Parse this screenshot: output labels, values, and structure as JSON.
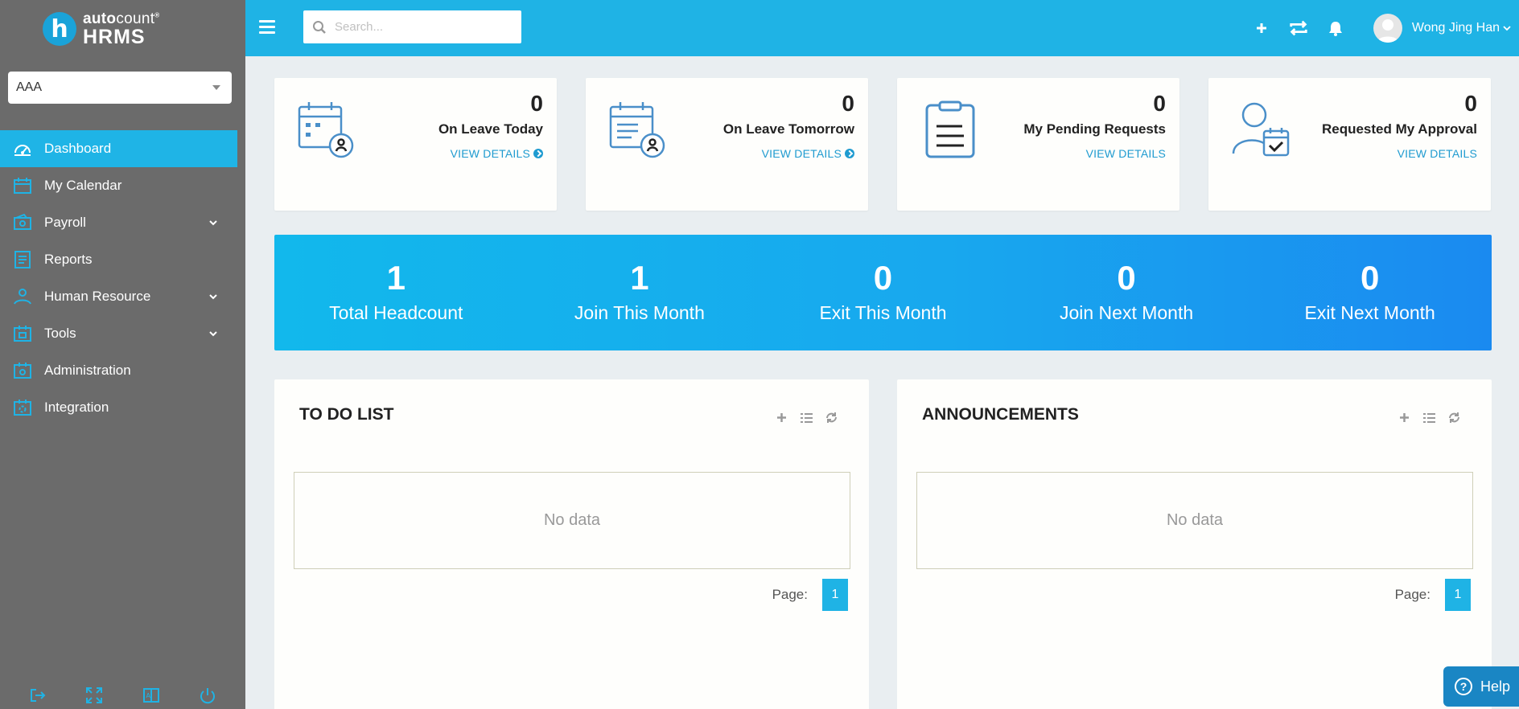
{
  "brand": {
    "badge": "h",
    "line1_bold": "auto",
    "line1_light": "count",
    "line2": "HRMS"
  },
  "company": {
    "selected": "AAA"
  },
  "sidebar": {
    "items": [
      {
        "label": "Dashboard",
        "icon": "dashboard-icon",
        "active": true,
        "expandable": false
      },
      {
        "label": "My Calendar",
        "icon": "calendar-icon",
        "active": false,
        "expandable": false
      },
      {
        "label": "Payroll",
        "icon": "payroll-icon",
        "active": false,
        "expandable": true
      },
      {
        "label": "Reports",
        "icon": "reports-icon",
        "active": false,
        "expandable": false
      },
      {
        "label": "Human Resource",
        "icon": "human-resource-icon",
        "active": false,
        "expandable": true
      },
      {
        "label": "Tools",
        "icon": "tools-icon",
        "active": false,
        "expandable": true
      },
      {
        "label": "Administration",
        "icon": "administration-icon",
        "active": false,
        "expandable": false
      },
      {
        "label": "Integration",
        "icon": "integration-icon",
        "active": false,
        "expandable": false
      }
    ],
    "footer_icons": [
      "logout-icon",
      "fullscreen-icon",
      "language-icon",
      "power-icon"
    ]
  },
  "topbar": {
    "search_placeholder": "Search...",
    "user_name": "Wong Jing Han"
  },
  "cards": [
    {
      "count": "0",
      "label": "On Leave Today",
      "link": "VIEW DETAILS",
      "arrow": true
    },
    {
      "count": "0",
      "label": "On Leave Tomorrow",
      "link": "VIEW DETAILS",
      "arrow": true
    },
    {
      "count": "0",
      "label": "My Pending Requests",
      "link": "VIEW DETAILS",
      "arrow": false
    },
    {
      "count": "0",
      "label": "Requested My Approval",
      "link": "VIEW DETAILS",
      "arrow": false
    }
  ],
  "headcount": [
    {
      "value": "1",
      "label": "Total Headcount"
    },
    {
      "value": "1",
      "label": "Join This Month"
    },
    {
      "value": "0",
      "label": "Exit This Month"
    },
    {
      "value": "0",
      "label": "Join Next Month"
    },
    {
      "value": "0",
      "label": "Exit Next Month"
    }
  ],
  "panels": {
    "todo": {
      "title": "TO DO LIST",
      "empty": "No data",
      "page_label": "Page:",
      "page": "1"
    },
    "announcements": {
      "title": "ANNOUNCEMENTS",
      "empty": "No data",
      "page_label": "Page:",
      "page": "1"
    }
  },
  "help": {
    "label": "Help"
  },
  "colors": {
    "accent": "#1fb3e5",
    "sidebar": "#6b6b6b",
    "link": "#1f9bd0",
    "banner_start": "#12b8ec",
    "banner_end": "#1a8af0"
  }
}
